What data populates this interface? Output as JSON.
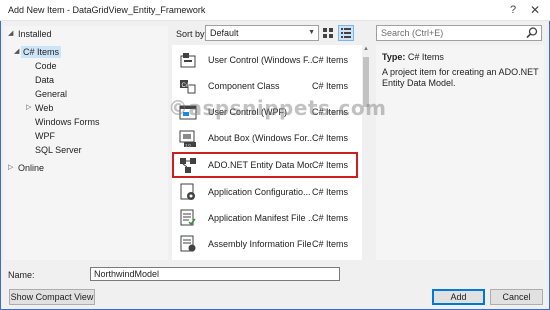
{
  "window": {
    "title": "Add New Item - DataGridView_Entity_Framework",
    "help_glyph": "?",
    "close_glyph": "✕"
  },
  "tree": {
    "installed": "Installed",
    "csharp_items": "C# Items",
    "children": [
      "Code",
      "Data",
      "General",
      "Web",
      "Windows Forms",
      "WPF",
      "SQL Server"
    ],
    "online": "Online"
  },
  "toolbar": {
    "sort_label": "Sort by:",
    "sort_value": "Default"
  },
  "search": {
    "placeholder": "Search (Ctrl+E)"
  },
  "items": [
    {
      "name": "User Control (Windows F...",
      "category": "C# Items",
      "icon": "user-control-icon"
    },
    {
      "name": "Component Class",
      "category": "C# Items",
      "icon": "component-class-icon"
    },
    {
      "name": "User Control (WPF)",
      "category": "C# Items",
      "icon": "wpf-user-control-icon"
    },
    {
      "name": "About Box (Windows For...",
      "category": "C# Items",
      "icon": "about-box-icon"
    },
    {
      "name": "ADO.NET Entity Data Model",
      "category": "C# Items",
      "icon": "entity-data-model-icon",
      "selected": true
    },
    {
      "name": "Application Configuratio...",
      "category": "C# Items",
      "icon": "app-config-icon"
    },
    {
      "name": "Application Manifest File ...",
      "category": "C# Items",
      "icon": "app-manifest-icon"
    },
    {
      "name": "Assembly Information File",
      "category": "C# Items",
      "icon": "assembly-info-icon"
    }
  ],
  "info": {
    "type_label": "Type:",
    "type_value": "C# Items",
    "description": "A project item for creating an ADO.NET Entity Data Model."
  },
  "watermark": "©aspsnippets.com",
  "footer": {
    "name_label": "Name:",
    "name_value": "NorthwindModel",
    "compact_button": "Show Compact View",
    "add_button": "Add",
    "cancel_button": "Cancel"
  },
  "colors": {
    "accent": "#3c6bc9",
    "selection": "#cce4f7",
    "highlight_border": "#cc1f1f"
  }
}
